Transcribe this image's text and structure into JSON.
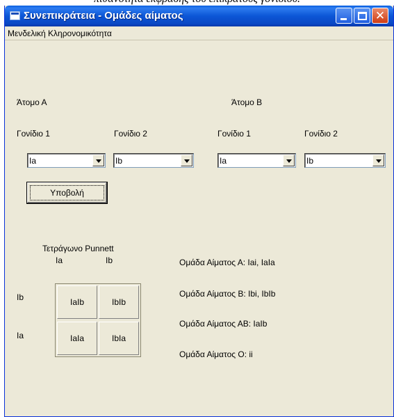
{
  "cropped_text": "πιθανότητα έκφρασης του επικρατούς γονιδίου.",
  "window": {
    "title": "Συνεπικράτεια - Ομάδες αίματος",
    "min_glyph": "_",
    "close_glyph": "✕"
  },
  "menu": {
    "items": [
      "Μενδελική Κληρονομικότητα"
    ]
  },
  "person_a": {
    "label": "Άτομο Α",
    "gene1_label": "Γονίδιο 1",
    "gene1_value": "Ia",
    "gene2_label": "Γονίδιο 2",
    "gene2_value": "Ib"
  },
  "person_b": {
    "label": "Άτομο Β",
    "gene1_label": "Γονίδιο 1",
    "gene1_value": "Ia",
    "gene2_label": "Γονίδιο 2",
    "gene2_value": "Ib"
  },
  "submit_label": "Υποβολή",
  "punnett": {
    "title": "Τετράγωνο Punnett",
    "col_headers": [
      "Ia",
      "Ib"
    ],
    "row_headers": [
      "Ib",
      "Ia"
    ],
    "cells": [
      [
        "IaIb",
        "IbIb"
      ],
      [
        "IaIa",
        "IbIa"
      ]
    ]
  },
  "results": [
    "Ομάδα Αίματος Α: Iai, IaIa",
    "Ομάδα Αίματος Β: Ibi, IbIb",
    "Ομάδα Αίματος ΑΒ:  IaIb",
    "Ομάδα Αίματος Ο: ii"
  ]
}
